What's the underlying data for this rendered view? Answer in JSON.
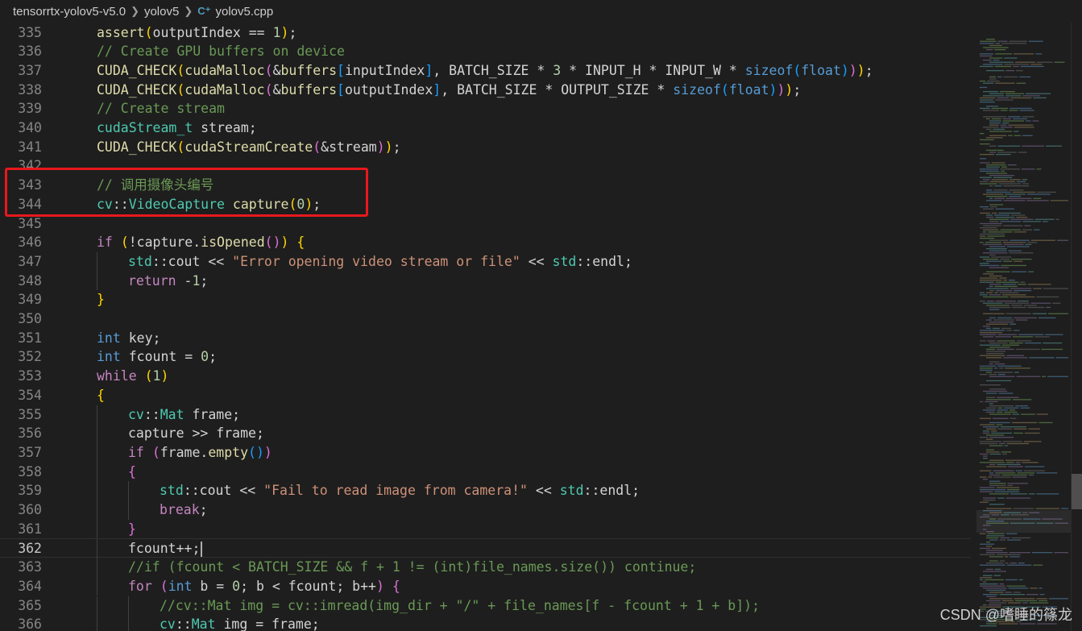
{
  "breadcrumb": {
    "items": [
      "tensorrtx-yolov5-v5.0",
      "yolov5",
      "yolov5.cpp"
    ],
    "file_icon": "C⁺"
  },
  "editor": {
    "language": "cpp",
    "current_line": 362,
    "lines": [
      {
        "n": "335",
        "indent": 1,
        "tokens": [
          [
            "fn",
            "assert"
          ],
          [
            "b1",
            "("
          ],
          [
            "pl",
            "outputIndex == "
          ],
          [
            "num",
            "1"
          ],
          [
            "b1",
            ")"
          ],
          [
            "pl",
            ";"
          ]
        ]
      },
      {
        "n": "336",
        "indent": 1,
        "tokens": [
          [
            "cm",
            "// Create GPU buffers on device"
          ]
        ]
      },
      {
        "n": "337",
        "indent": 1,
        "tokens": [
          [
            "fn",
            "CUDA_CHECK"
          ],
          [
            "b1",
            "("
          ],
          [
            "fn",
            "cudaMalloc"
          ],
          [
            "b2",
            "("
          ],
          [
            "pl",
            "&"
          ],
          [
            "fn",
            "buffers"
          ],
          [
            "b3",
            "["
          ],
          [
            "pl",
            "inputIndex"
          ],
          [
            "b3",
            "]"
          ],
          [
            "pl",
            ", BATCH_SIZE * "
          ],
          [
            "num",
            "3"
          ],
          [
            "pl",
            " * INPUT_H * INPUT_W * "
          ],
          [
            "kw",
            "sizeof"
          ],
          [
            "b3",
            "("
          ],
          [
            "kw",
            "float"
          ],
          [
            "b3",
            ")"
          ],
          [
            "b2",
            ")"
          ],
          [
            "b1",
            ")"
          ],
          [
            "pl",
            ";"
          ]
        ]
      },
      {
        "n": "338",
        "indent": 1,
        "tokens": [
          [
            "fn",
            "CUDA_CHECK"
          ],
          [
            "b1",
            "("
          ],
          [
            "fn",
            "cudaMalloc"
          ],
          [
            "b2",
            "("
          ],
          [
            "pl",
            "&"
          ],
          [
            "fn",
            "buffers"
          ],
          [
            "b3",
            "["
          ],
          [
            "pl",
            "outputIndex"
          ],
          [
            "b3",
            "]"
          ],
          [
            "pl",
            ", BATCH_SIZE * OUTPUT_SIZE * "
          ],
          [
            "kw",
            "sizeof"
          ],
          [
            "b3",
            "("
          ],
          [
            "kw",
            "float"
          ],
          [
            "b3",
            ")"
          ],
          [
            "b2",
            ")"
          ],
          [
            "b1",
            ")"
          ],
          [
            "pl",
            ";"
          ]
        ]
      },
      {
        "n": "339",
        "indent": 1,
        "tokens": [
          [
            "cm",
            "// Create stream"
          ]
        ]
      },
      {
        "n": "340",
        "indent": 1,
        "tokens": [
          [
            "type",
            "cudaStream_t"
          ],
          [
            "pl",
            " stream;"
          ]
        ]
      },
      {
        "n": "341",
        "indent": 1,
        "tokens": [
          [
            "fn",
            "CUDA_CHECK"
          ],
          [
            "b1",
            "("
          ],
          [
            "fn",
            "cudaStreamCreate"
          ],
          [
            "b2",
            "("
          ],
          [
            "pl",
            "&stream"
          ],
          [
            "b2",
            ")"
          ],
          [
            "b1",
            ")"
          ],
          [
            "pl",
            ";"
          ]
        ]
      },
      {
        "n": "342",
        "indent": 0,
        "tokens": []
      },
      {
        "n": "343",
        "indent": 1,
        "tokens": [
          [
            "cm",
            "// 调用摄像头编号"
          ]
        ]
      },
      {
        "n": "344",
        "indent": 1,
        "tokens": [
          [
            "type",
            "cv"
          ],
          [
            "pl",
            "::"
          ],
          [
            "type",
            "VideoCapture"
          ],
          [
            "pl",
            " "
          ],
          [
            "fn",
            "capture"
          ],
          [
            "b1",
            "("
          ],
          [
            "num",
            "0"
          ],
          [
            "b1",
            ")"
          ],
          [
            "pl",
            ";"
          ]
        ]
      },
      {
        "n": "345",
        "indent": 0,
        "tokens": []
      },
      {
        "n": "346",
        "indent": 1,
        "tokens": [
          [
            "ctl",
            "if"
          ],
          [
            "pl",
            " "
          ],
          [
            "b1",
            "("
          ],
          [
            "pl",
            "!capture."
          ],
          [
            "fn",
            "isOpened"
          ],
          [
            "b2",
            "()"
          ],
          [
            "b1",
            ")"
          ],
          [
            "pl",
            " "
          ],
          [
            "b1",
            "{"
          ]
        ]
      },
      {
        "n": "347",
        "indent": 2,
        "tokens": [
          [
            "type",
            "std"
          ],
          [
            "pl",
            "::cout << "
          ],
          [
            "str",
            "\"Error opening video stream or file\""
          ],
          [
            "pl",
            " << "
          ],
          [
            "type",
            "std"
          ],
          [
            "pl",
            "::endl;"
          ]
        ]
      },
      {
        "n": "348",
        "indent": 2,
        "tokens": [
          [
            "ctl",
            "return"
          ],
          [
            "pl",
            " -"
          ],
          [
            "num",
            "1"
          ],
          [
            "pl",
            ";"
          ]
        ]
      },
      {
        "n": "349",
        "indent": 1,
        "tokens": [
          [
            "b1",
            "}"
          ]
        ]
      },
      {
        "n": "350",
        "indent": 0,
        "tokens": []
      },
      {
        "n": "351",
        "indent": 1,
        "tokens": [
          [
            "kw",
            "int"
          ],
          [
            "pl",
            " key;"
          ]
        ]
      },
      {
        "n": "352",
        "indent": 1,
        "tokens": [
          [
            "kw",
            "int"
          ],
          [
            "pl",
            " fcount = "
          ],
          [
            "num",
            "0"
          ],
          [
            "pl",
            ";"
          ]
        ]
      },
      {
        "n": "353",
        "indent": 1,
        "tokens": [
          [
            "ctl",
            "while"
          ],
          [
            "pl",
            " "
          ],
          [
            "b1",
            "("
          ],
          [
            "num",
            "1"
          ],
          [
            "b1",
            ")"
          ]
        ]
      },
      {
        "n": "354",
        "indent": 1,
        "tokens": [
          [
            "b1",
            "{"
          ]
        ]
      },
      {
        "n": "355",
        "indent": 2,
        "tokens": [
          [
            "type",
            "cv"
          ],
          [
            "pl",
            "::"
          ],
          [
            "type",
            "Mat"
          ],
          [
            "pl",
            " frame;"
          ]
        ]
      },
      {
        "n": "356",
        "indent": 2,
        "tokens": [
          [
            "pl",
            "capture >> frame;"
          ]
        ]
      },
      {
        "n": "357",
        "indent": 2,
        "tokens": [
          [
            "ctl",
            "if"
          ],
          [
            "pl",
            " "
          ],
          [
            "b2",
            "("
          ],
          [
            "pl",
            "frame."
          ],
          [
            "fn",
            "empty"
          ],
          [
            "b3",
            "()"
          ],
          [
            "b2",
            ")"
          ]
        ]
      },
      {
        "n": "358",
        "indent": 2,
        "tokens": [
          [
            "b2",
            "{"
          ]
        ]
      },
      {
        "n": "359",
        "indent": 3,
        "tokens": [
          [
            "type",
            "std"
          ],
          [
            "pl",
            "::cout << "
          ],
          [
            "str",
            "\"Fail to read image from camera!\""
          ],
          [
            "pl",
            " << "
          ],
          [
            "type",
            "std"
          ],
          [
            "pl",
            "::endl;"
          ]
        ]
      },
      {
        "n": "360",
        "indent": 3,
        "tokens": [
          [
            "ctl",
            "break"
          ],
          [
            "pl",
            ";"
          ]
        ]
      },
      {
        "n": "361",
        "indent": 2,
        "tokens": [
          [
            "b2",
            "}"
          ]
        ]
      },
      {
        "n": "362",
        "indent": 2,
        "tokens": [
          [
            "pl",
            "fcount++;"
          ]
        ]
      },
      {
        "n": "363",
        "indent": 2,
        "tokens": [
          [
            "cm",
            "//if (fcount < BATCH_SIZE && f + 1 != (int)file_names.size()) continue;"
          ]
        ]
      },
      {
        "n": "364",
        "indent": 2,
        "tokens": [
          [
            "ctl",
            "for"
          ],
          [
            "pl",
            " "
          ],
          [
            "b2",
            "("
          ],
          [
            "kw",
            "int"
          ],
          [
            "pl",
            " b = "
          ],
          [
            "num",
            "0"
          ],
          [
            "pl",
            "; b < fcount; b++"
          ],
          [
            "b2",
            ")"
          ],
          [
            "pl",
            " "
          ],
          [
            "b2",
            "{"
          ]
        ]
      },
      {
        "n": "365",
        "indent": 3,
        "tokens": [
          [
            "cm",
            "//cv::Mat img = cv::imread(img_dir + \"/\" + file_names[f - fcount + 1 + b]);"
          ]
        ]
      },
      {
        "n": "366",
        "indent": 3,
        "tokens": [
          [
            "type",
            "cv"
          ],
          [
            "pl",
            "::"
          ],
          [
            "type",
            "Mat"
          ],
          [
            "pl",
            " img = frame;"
          ]
        ]
      }
    ]
  },
  "watermark": "CSDN @嗜睡的篠龙",
  "colors": {
    "background": "#1e1e1e",
    "highlight_box": "#e8181d",
    "line_number": "#858585",
    "comment": "#6a9955",
    "keyword": "#569cd6",
    "function": "#dcdcaa",
    "string": "#ce9178",
    "type": "#4ec9b0"
  }
}
